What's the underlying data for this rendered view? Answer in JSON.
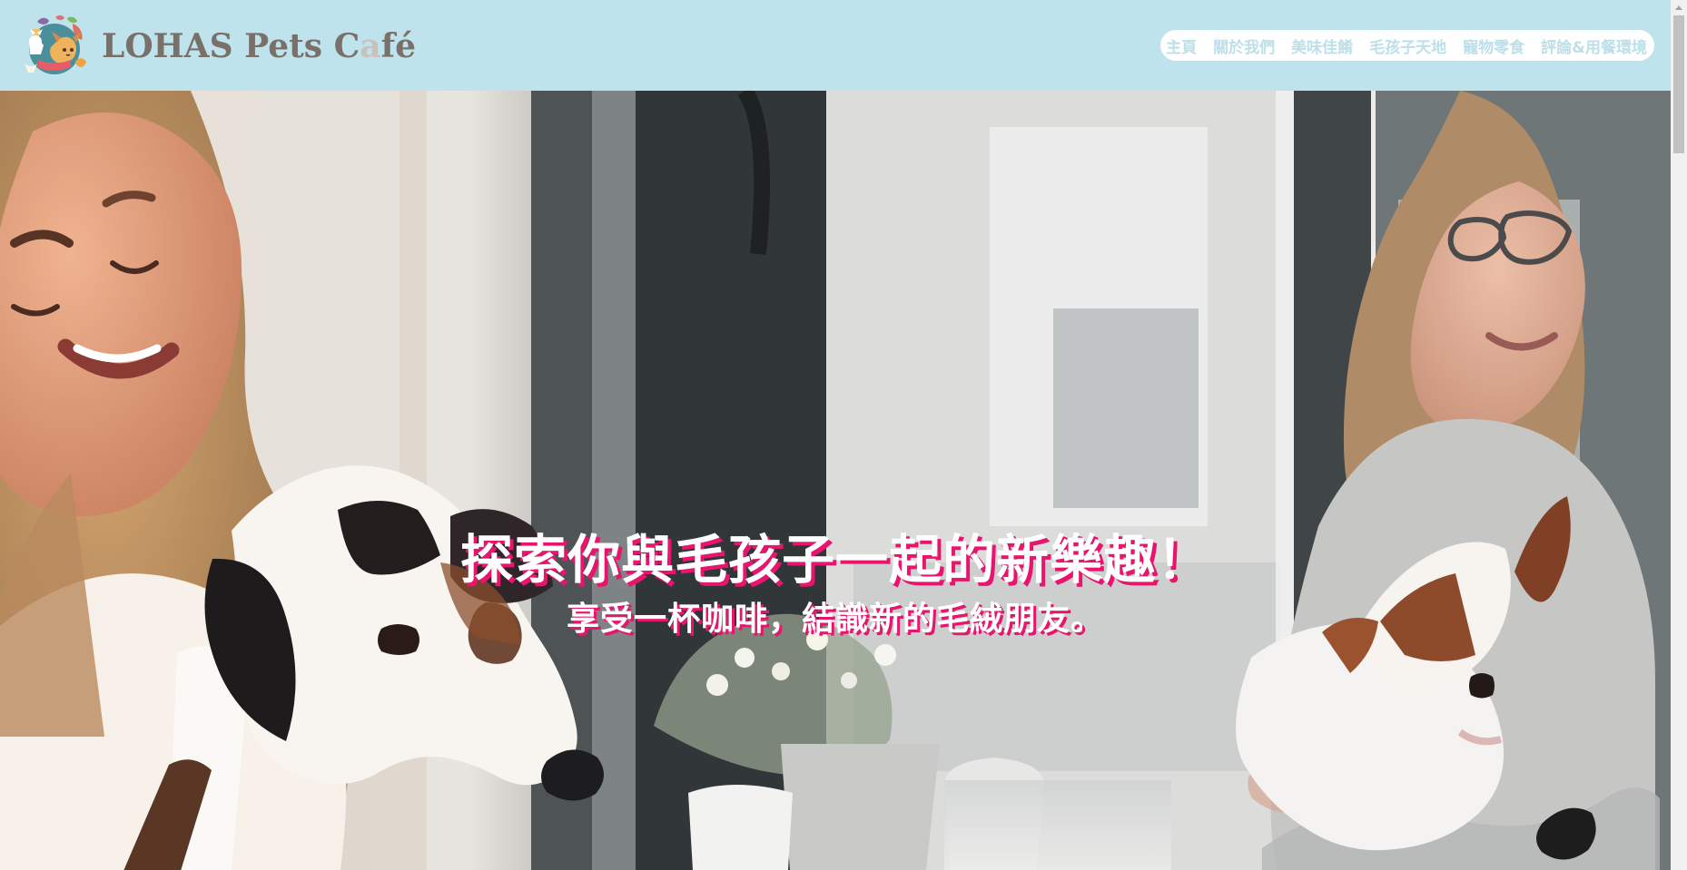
{
  "header": {
    "brand_main": "LOHAS Pets C",
    "brand_faded": "a",
    "brand_end": "fé",
    "logo_icon": "pet-cafe-logo-icon"
  },
  "nav": {
    "items": [
      {
        "label": "主頁"
      },
      {
        "label": "關於我們"
      },
      {
        "label": "美味佳餚"
      },
      {
        "label": "毛孩子天地"
      },
      {
        "label": "寵物零食"
      },
      {
        "label": "評論&用餐環境"
      }
    ]
  },
  "hero": {
    "headline": "探索你與毛孩子一起的新樂趣！",
    "subline": "享受一杯咖啡，結識新的毛絨朋友。",
    "image": "woman-with-dogs-photo"
  },
  "colors": {
    "header_bg": "#bfe3ec",
    "brand_text": "#7a706a",
    "nav_text": "#bde0e8",
    "nav_bg": "#ffffff",
    "hero_shadow": "#e7156d"
  }
}
